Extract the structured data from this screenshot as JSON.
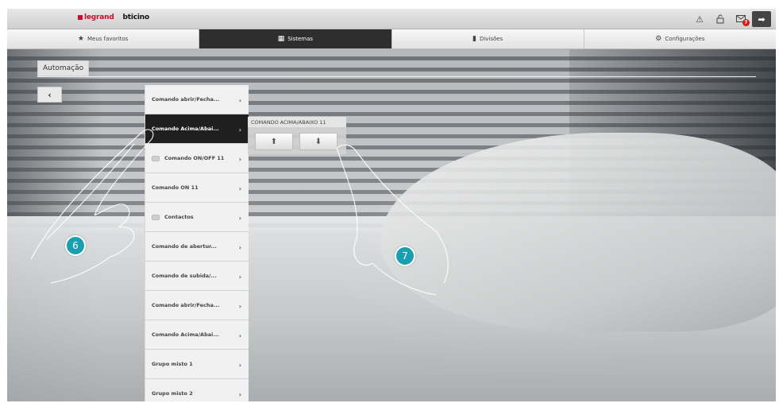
{
  "brand": {
    "legrand": "legrand",
    "bticino": "bticino"
  },
  "topbar_icons": [
    "warning-icon",
    "lock-icon",
    "mail-icon",
    "logout-icon"
  ],
  "notification_count": "7",
  "nav": {
    "tabs": [
      {
        "label": "Meus favoritos",
        "icon": "star-icon"
      },
      {
        "label": "Sistemas",
        "icon": "systems-icon"
      },
      {
        "label": "Divisões",
        "icon": "room-icon"
      },
      {
        "label": "Configurações",
        "icon": "gear-icon"
      }
    ],
    "active": "Sistemas"
  },
  "page_title": "Automação",
  "back_label": "‹",
  "list": {
    "items": [
      {
        "label": "Comando abrir/Fecha...",
        "bulb": false
      },
      {
        "label": "Comando Acima/Abai...",
        "bulb": false
      },
      {
        "label": "Comando ON/OFF 11",
        "bulb": true
      },
      {
        "label": "Comando ON 11",
        "bulb": false
      },
      {
        "label": "Contactos",
        "bulb": true
      },
      {
        "label": "Comando de abertur...",
        "bulb": false
      },
      {
        "label": "Comando de subida/...",
        "bulb": false
      },
      {
        "label": "Comando abrir/Fecha...",
        "bulb": false
      },
      {
        "label": "Comando Acima/Abai...",
        "bulb": false
      },
      {
        "label": "Grupo misto 1",
        "bulb": false
      },
      {
        "label": "Grupo misto 2",
        "bulb": false
      }
    ],
    "selected_index": 1
  },
  "detail": {
    "title": "COMANDO ACIMA/ABAIXO 11",
    "up_label": "⬆",
    "down_label": "⬇"
  },
  "callouts": [
    "6",
    "7"
  ],
  "colors": {
    "accent": "#1a9fb0",
    "active_tab": "#2e2e2e",
    "brand_red": "#c8102e"
  }
}
